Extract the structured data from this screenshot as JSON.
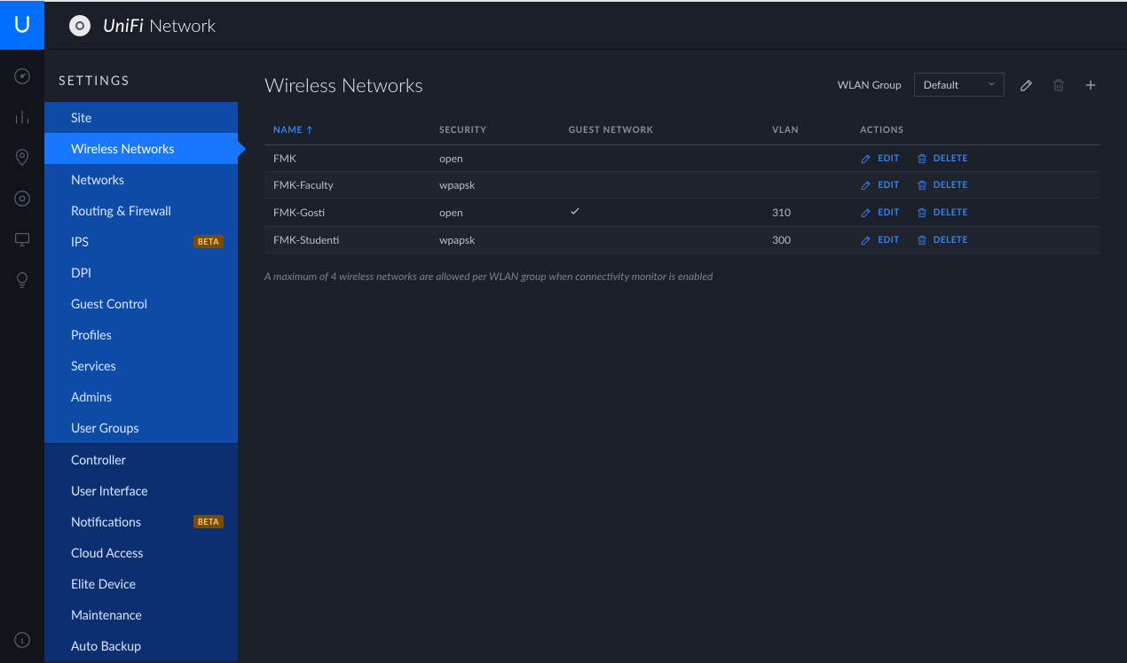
{
  "brand": {
    "unifi": "UniFi",
    "network": "Network"
  },
  "sidebar": {
    "title": "SETTINGS",
    "group1": [
      {
        "label": "Site"
      },
      {
        "label": "Wireless Networks",
        "active": true
      },
      {
        "label": "Networks"
      },
      {
        "label": "Routing & Firewall"
      },
      {
        "label": "IPS",
        "badge": "BETA"
      },
      {
        "label": "DPI"
      },
      {
        "label": "Guest Control"
      },
      {
        "label": "Profiles"
      },
      {
        "label": "Services"
      },
      {
        "label": "Admins"
      },
      {
        "label": "User Groups"
      }
    ],
    "group2": [
      {
        "label": "Controller"
      },
      {
        "label": "User Interface"
      },
      {
        "label": "Notifications",
        "badge": "BETA"
      },
      {
        "label": "Cloud Access"
      },
      {
        "label": "Elite Device"
      },
      {
        "label": "Maintenance"
      },
      {
        "label": "Auto Backup"
      }
    ]
  },
  "page": {
    "title": "Wireless Networks",
    "wlan_group_label": "WLAN Group",
    "wlan_group_value": "Default",
    "footnote": "A maximum of 4 wireless networks are allowed per WLAN group when connectivity monitor is enabled",
    "columns": {
      "name": "NAME",
      "security": "SECURITY",
      "guest": "GUEST NETWORK",
      "vlan": "VLAN",
      "actions": "ACTIONS"
    },
    "action_labels": {
      "edit": "EDIT",
      "delete": "DELETE"
    },
    "rows": [
      {
        "name": "FMK",
        "security": "open",
        "guest": false,
        "vlan": ""
      },
      {
        "name": "FMK-Faculty",
        "security": "wpapsk",
        "guest": false,
        "vlan": ""
      },
      {
        "name": "FMK-Gosti",
        "security": "open",
        "guest": true,
        "vlan": "310"
      },
      {
        "name": "FMK-Studenti",
        "security": "wpapsk",
        "guest": false,
        "vlan": "300"
      }
    ]
  }
}
